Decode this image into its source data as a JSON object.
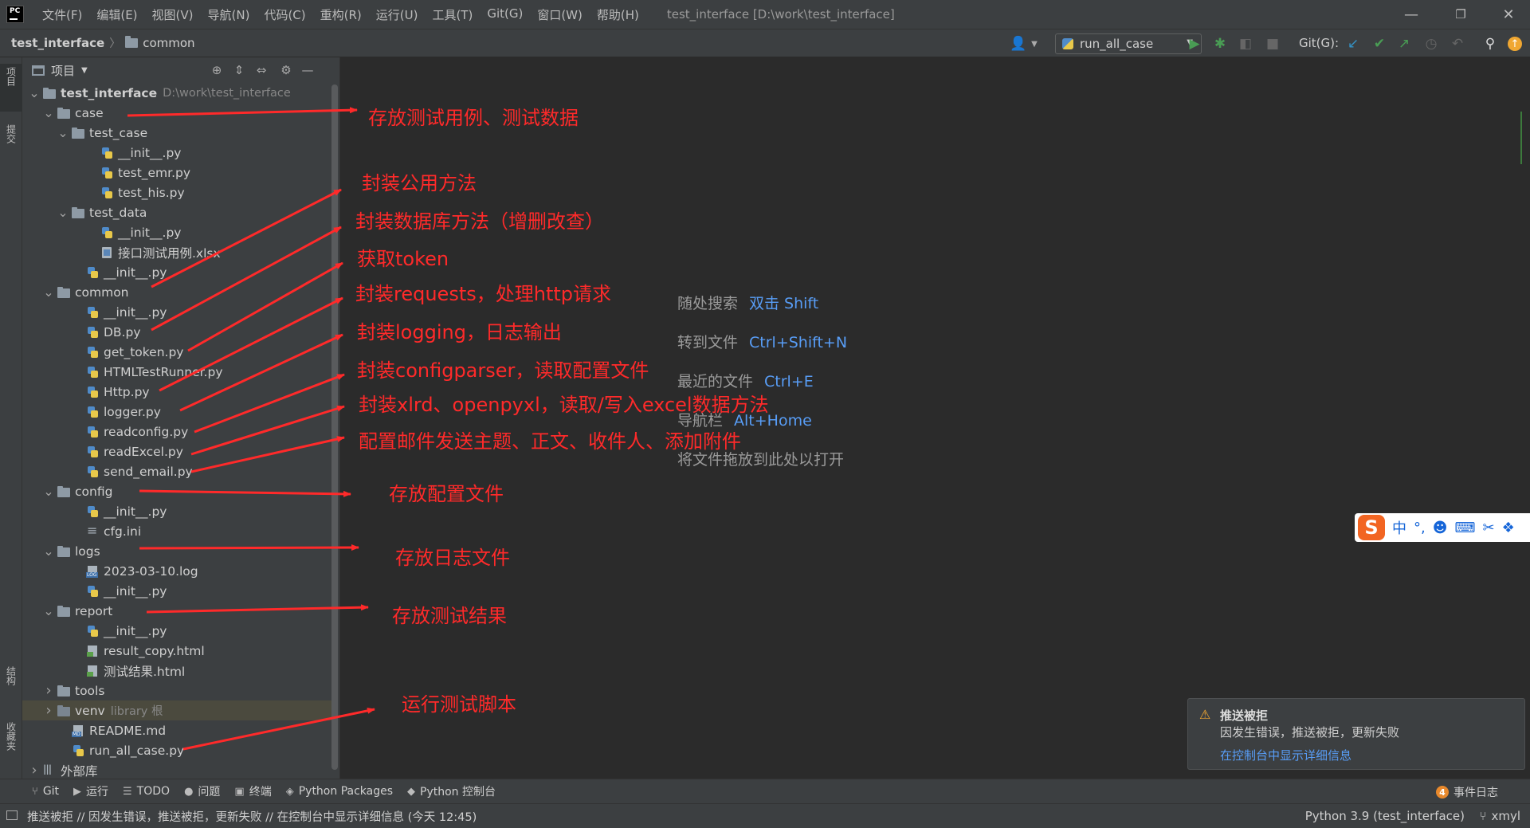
{
  "titlebar": {
    "menu": [
      "文件(F)",
      "编辑(E)",
      "视图(V)",
      "导航(N)",
      "代码(C)",
      "重构(R)",
      "运行(U)",
      "工具(T)",
      "Git(G)",
      "窗口(W)",
      "帮助(H)"
    ],
    "window_title": "test_interface [D:\\work\\test_interface]",
    "minimize": "—",
    "restore": "❐",
    "close": "✕"
  },
  "navbar": {
    "project": "test_interface",
    "folder": "common",
    "run_config": "run_all_case",
    "git_label": "Git(G):"
  },
  "left_stripe": {
    "project_tab": "项目",
    "commit_tab": "提交",
    "structure_tab": "结构",
    "bookmarks_tab": "收藏夹"
  },
  "panel": {
    "title": "项目"
  },
  "tree": [
    {
      "label": "test_interface",
      "extra": "D:\\work\\test_interface",
      "icon": "folder",
      "chevron": "down",
      "indent": 0,
      "bold": true
    },
    {
      "label": "case",
      "icon": "folder",
      "chevron": "down",
      "indent": 1
    },
    {
      "label": "test_case",
      "icon": "folder",
      "chevron": "down",
      "indent": 2
    },
    {
      "label": "__init__.py",
      "icon": "py",
      "indent": 4
    },
    {
      "label": "test_emr.py",
      "icon": "py",
      "indent": 4
    },
    {
      "label": "test_his.py",
      "icon": "py",
      "indent": 4
    },
    {
      "label": "test_data",
      "icon": "folder",
      "chevron": "down",
      "indent": 2
    },
    {
      "label": "__init__.py",
      "icon": "py",
      "indent": 4
    },
    {
      "label": "接口测试用例.xlsx",
      "icon": "xls",
      "indent": 4
    },
    {
      "label": "__init__.py",
      "icon": "py",
      "indent": 3
    },
    {
      "label": "common",
      "icon": "folder",
      "chevron": "down",
      "indent": 1
    },
    {
      "label": "__init__.py",
      "icon": "py",
      "indent": 3
    },
    {
      "label": "DB.py",
      "icon": "py",
      "indent": 3
    },
    {
      "label": "get_token.py",
      "icon": "py",
      "indent": 3
    },
    {
      "label": "HTMLTestRunner.py",
      "icon": "py",
      "indent": 3
    },
    {
      "label": "Http.py",
      "icon": "py",
      "indent": 3
    },
    {
      "label": "logger.py",
      "icon": "py",
      "indent": 3
    },
    {
      "label": "readconfig.py",
      "icon": "py",
      "indent": 3
    },
    {
      "label": "readExcel.py",
      "icon": "py",
      "indent": 3
    },
    {
      "label": "send_email.py",
      "icon": "py",
      "indent": 3
    },
    {
      "label": "config",
      "icon": "folder",
      "chevron": "down",
      "indent": 1
    },
    {
      "label": "__init__.py",
      "icon": "py",
      "indent": 3
    },
    {
      "label": "cfg.ini",
      "icon": "ini",
      "indent": 3
    },
    {
      "label": "logs",
      "icon": "folder",
      "chevron": "down",
      "indent": 1
    },
    {
      "label": "2023-03-10.log",
      "icon": "log",
      "indent": 3
    },
    {
      "label": "__init__.py",
      "icon": "py",
      "indent": 3
    },
    {
      "label": "report",
      "icon": "folder",
      "chevron": "down",
      "indent": 1
    },
    {
      "label": "__init__.py",
      "icon": "py",
      "indent": 3
    },
    {
      "label": "result_copy.html",
      "icon": "html",
      "indent": 3
    },
    {
      "label": "测试结果.html",
      "icon": "html",
      "indent": 3
    },
    {
      "label": "tools",
      "icon": "folder",
      "chevron": "right",
      "indent": 1
    },
    {
      "label": "venv",
      "extra": "library 根",
      "icon": "folder excl",
      "chevron": "right",
      "indent": 1,
      "highlight": true
    },
    {
      "label": "README.md",
      "icon": "md",
      "indent": 2
    },
    {
      "label": "run_all_case.py",
      "icon": "py",
      "indent": 2
    },
    {
      "label": "外部库",
      "icon": "lib",
      "chevron": "right",
      "indent": 0
    }
  ],
  "editor_hints": [
    {
      "text": "随处搜索",
      "key": "双击 Shift"
    },
    {
      "text": "转到文件",
      "key": "Ctrl+Shift+N"
    },
    {
      "text": "最近的文件",
      "key": "Ctrl+E"
    },
    {
      "text": "导航栏",
      "key": "Alt+Home"
    },
    {
      "text": "将文件拖放到此处以打开",
      "key": ""
    }
  ],
  "annotations": [
    "存放测试用例、测试数据",
    "封装公用方法",
    "封装数据库方法（增删改查）",
    "获取token",
    "封装requests，处理http请求",
    "封装logging，日志输出",
    "封装configparser，读取配置文件",
    "封装xlrd、openpyxl，读取/写入excel数据方法",
    "配置邮件发送主题、正文、收件人、添加附件",
    "存放配置文件",
    "存放日志文件",
    "存放测试结果",
    "运行测试脚本"
  ],
  "ime": {
    "logo": "S",
    "items": [
      "中",
      "°,",
      "☻",
      "⌨",
      "✂",
      "❖"
    ]
  },
  "notification": {
    "title": "推送被拒",
    "body": "因发生错误，推送被拒，更新失败",
    "link": "在控制台中显示详细信息"
  },
  "tool_tabs": [
    {
      "icon": "⑂",
      "label": "Git"
    },
    {
      "icon": "▶",
      "label": "运行"
    },
    {
      "icon": "☰",
      "label": "TODO"
    },
    {
      "icon": "●",
      "label": "问题"
    },
    {
      "icon": "▣",
      "label": "终端"
    },
    {
      "icon": "◈",
      "label": "Python Packages"
    },
    {
      "icon": "◆",
      "label": "Python 控制台"
    }
  ],
  "event_log": {
    "count": "4",
    "label": "事件日志"
  },
  "status": {
    "message": "推送被拒 // 因发生错误，推送被拒，更新失败 // 在控制台中显示详细信息 (今天 12:45)",
    "interpreter": "Python 3.9 (test_interface)",
    "branch": "xmyl"
  },
  "colors": {
    "annotation": "#ff2a2a",
    "link": "#589df6",
    "background": "#2b2b2b",
    "panel": "#3c3f41"
  }
}
